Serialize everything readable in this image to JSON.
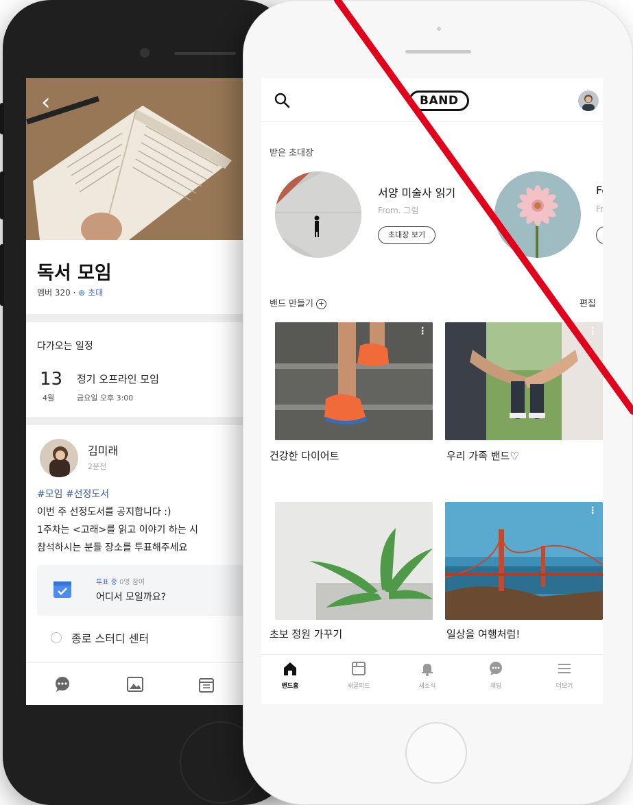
{
  "back_screen": {
    "back_label": "‹",
    "group_title": "독서 모임",
    "member_count": "멤버 320",
    "invite_label": "초대",
    "schedule_header": "다가오는 일정",
    "event_day": "13",
    "event_month": "4월",
    "event_title": "정기 오프라인 모임",
    "event_time": "금요일 오후 3:00",
    "author_name": "김미래",
    "post_ago": "2분전",
    "tags": "#모임 #선정도서",
    "body_lines": [
      "이번 주 선정도서를 공지합니다 :)",
      "1주차는 <고래>를 읽고 이야기 하는 시",
      "참석하시는 분들 장소를 투표해주세요"
    ],
    "vote_status": "투표 중",
    "vote_count": "0명 참여",
    "vote_question": "어디서 모일까요?",
    "vote_option": "종로 스터디 센터"
  },
  "header": {
    "logo": "BAND"
  },
  "invitations": {
    "section_label": "받은 초대장",
    "items": [
      {
        "title": "서양 미술사 읽기",
        "from": "From. 그림",
        "button": "초대장 보기"
      },
      {
        "title": "Fe",
        "from": "Fro",
        "button": "초"
      }
    ]
  },
  "bands": {
    "create_label": "밴드 만들기",
    "edit_label": "편집",
    "items": [
      {
        "name": "건강한 다이어트"
      },
      {
        "name": "우리 가족 밴드♡"
      },
      {
        "name": "초보 정원 가꾸기"
      },
      {
        "name": "일상을 여행처럼!"
      }
    ]
  },
  "tabbar": {
    "items": [
      {
        "label": "밴드홈",
        "icon": "home-icon"
      },
      {
        "label": "새글피드",
        "icon": "feed-icon"
      },
      {
        "label": "새소식",
        "icon": "bell-icon"
      },
      {
        "label": "채팅",
        "icon": "chat-icon"
      },
      {
        "label": "더보기",
        "icon": "menu-icon"
      }
    ]
  },
  "colors": {
    "accent_blue": "#3d6fd1",
    "mark_red": "#e0001b"
  }
}
